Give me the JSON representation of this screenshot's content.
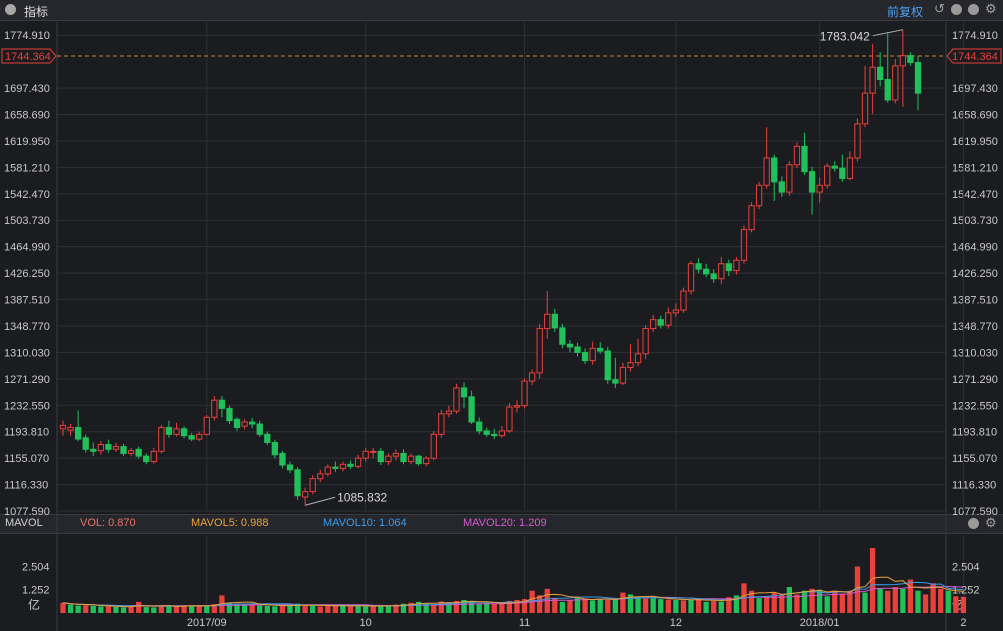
{
  "header": {
    "title": "指标",
    "fq_label": "前复权"
  },
  "volume_header": {
    "name": "MAVOL",
    "vol": "VOL: 0.870",
    "ma5": "MAVOL5: 0.988",
    "ma10": "MAVOL10: 1.064",
    "ma20": "MAVOL20: 1.209"
  },
  "colors": {
    "up": "#e8413c",
    "down": "#22c05a",
    "ma5": "#e8a33c",
    "ma10": "#3c9be8",
    "ma20": "#d25bd2",
    "bg": "#1b1c20",
    "grid": "#2e3036"
  },
  "chart_data": [
    {
      "type": "candlestick",
      "y_ticks": [
        "1774.910",
        "1697.430",
        "1658.690",
        "1619.950",
        "1581.210",
        "1542.470",
        "1503.730",
        "1464.990",
        "1426.250",
        "1387.510",
        "1348.770",
        "1310.030",
        "1271.290",
        "1232.550",
        "1193.810",
        "1155.070",
        "1116.330",
        "1077.590"
      ],
      "ylim": [
        1077.59,
        1794.28
      ],
      "current_price": "1744.364",
      "max_label": "1783.042",
      "min_label": "1085.832",
      "x_ticks": [
        "2017/09",
        "10",
        "11",
        "12",
        "2018/01",
        "2"
      ],
      "x_tick_index": [
        19,
        40,
        61,
        81,
        100,
        119
      ],
      "candles": [
        [
          1198,
          1203,
          1188,
          1210
        ],
        [
          1196,
          1200,
          1188,
          1205
        ],
        [
          1200,
          1183,
          1180,
          1225
        ],
        [
          1185,
          1168,
          1163,
          1190
        ],
        [
          1168,
          1165,
          1158,
          1178
        ],
        [
          1166,
          1175,
          1160,
          1180
        ],
        [
          1175,
          1168,
          1163,
          1182
        ],
        [
          1168,
          1172,
          1164,
          1178
        ],
        [
          1172,
          1162,
          1158,
          1176
        ],
        [
          1162,
          1166,
          1158,
          1170
        ],
        [
          1168,
          1158,
          1154,
          1172
        ],
        [
          1158,
          1150,
          1146,
          1162
        ],
        [
          1150,
          1165,
          1147,
          1170
        ],
        [
          1165,
          1200,
          1162,
          1204
        ],
        [
          1200,
          1190,
          1185,
          1210
        ],
        [
          1190,
          1198,
          1187,
          1207
        ],
        [
          1198,
          1188,
          1184,
          1202
        ],
        [
          1188,
          1183,
          1180,
          1192
        ],
        [
          1183,
          1190,
          1180,
          1194
        ],
        [
          1190,
          1215,
          1188,
          1218
        ],
        [
          1215,
          1240,
          1210,
          1246
        ],
        [
          1240,
          1228,
          1215,
          1246
        ],
        [
          1228,
          1210,
          1205,
          1232
        ],
        [
          1212,
          1200,
          1195,
          1215
        ],
        [
          1202,
          1208,
          1197,
          1212
        ],
        [
          1208,
          1205,
          1199,
          1214
        ],
        [
          1205,
          1190,
          1186,
          1210
        ],
        [
          1190,
          1178,
          1174,
          1194
        ],
        [
          1178,
          1160,
          1155,
          1182
        ],
        [
          1162,
          1145,
          1140,
          1166
        ],
        [
          1145,
          1138,
          1133,
          1150
        ],
        [
          1138,
          1100,
          1094,
          1142
        ],
        [
          1098,
          1106,
          1086,
          1112
        ],
        [
          1106,
          1125,
          1102,
          1130
        ],
        [
          1125,
          1132,
          1120,
          1138
        ],
        [
          1132,
          1142,
          1128,
          1146
        ],
        [
          1142,
          1140,
          1135,
          1150
        ],
        [
          1140,
          1146,
          1136,
          1150
        ],
        [
          1146,
          1143,
          1139,
          1152
        ],
        [
          1143,
          1155,
          1140,
          1160
        ],
        [
          1155,
          1165,
          1150,
          1170
        ],
        [
          1165,
          1165,
          1155,
          1170
        ],
        [
          1165,
          1150,
          1145,
          1170
        ],
        [
          1150,
          1158,
          1145,
          1162
        ],
        [
          1158,
          1162,
          1152,
          1168
        ],
        [
          1162,
          1150,
          1146,
          1168
        ],
        [
          1150,
          1158,
          1146,
          1162
        ],
        [
          1158,
          1147,
          1144,
          1160
        ],
        [
          1147,
          1155,
          1143,
          1158
        ],
        [
          1155,
          1190,
          1152,
          1195
        ],
        [
          1190,
          1220,
          1185,
          1226
        ],
        [
          1220,
          1224,
          1215,
          1232
        ],
        [
          1224,
          1258,
          1220,
          1264
        ],
        [
          1258,
          1245,
          1228,
          1266
        ],
        [
          1245,
          1208,
          1205,
          1254
        ],
        [
          1208,
          1195,
          1190,
          1215
        ],
        [
          1195,
          1190,
          1186,
          1200
        ],
        [
          1190,
          1188,
          1183,
          1198
        ],
        [
          1188,
          1195,
          1185,
          1202
        ],
        [
          1195,
          1230,
          1192,
          1236
        ],
        [
          1230,
          1232,
          1222,
          1240
        ],
        [
          1232,
          1268,
          1228,
          1272
        ],
        [
          1268,
          1280,
          1262,
          1285
        ],
        [
          1280,
          1345,
          1272,
          1352
        ],
        [
          1345,
          1366,
          1330,
          1400
        ],
        [
          1366,
          1346,
          1340,
          1374
        ],
        [
          1346,
          1322,
          1316,
          1352
        ],
        [
          1322,
          1318,
          1310,
          1328
        ],
        [
          1318,
          1310,
          1304,
          1324
        ],
        [
          1310,
          1298,
          1293,
          1316
        ],
        [
          1298,
          1316,
          1292,
          1326
        ],
        [
          1316,
          1312,
          1308,
          1325
        ],
        [
          1312,
          1270,
          1264,
          1318
        ],
        [
          1270,
          1265,
          1258,
          1302
        ],
        [
          1265,
          1288,
          1262,
          1295
        ],
        [
          1288,
          1295,
          1282,
          1322
        ],
        [
          1295,
          1308,
          1290,
          1330
        ],
        [
          1308,
          1345,
          1300,
          1350
        ],
        [
          1345,
          1358,
          1340,
          1365
        ],
        [
          1358,
          1350,
          1345,
          1364
        ],
        [
          1350,
          1368,
          1345,
          1376
        ],
        [
          1368,
          1372,
          1362,
          1382
        ],
        [
          1372,
          1400,
          1368,
          1405
        ],
        [
          1400,
          1440,
          1395,
          1444
        ],
        [
          1440,
          1432,
          1426,
          1448
        ],
        [
          1432,
          1425,
          1420,
          1440
        ],
        [
          1425,
          1418,
          1412,
          1432
        ],
        [
          1418,
          1440,
          1410,
          1450
        ],
        [
          1440,
          1430,
          1422,
          1446
        ],
        [
          1430,
          1445,
          1424,
          1450
        ],
        [
          1445,
          1490,
          1440,
          1496
        ],
        [
          1490,
          1525,
          1486,
          1530
        ],
        [
          1525,
          1555,
          1520,
          1560
        ],
        [
          1555,
          1595,
          1550,
          1640
        ],
        [
          1595,
          1560,
          1532,
          1600
        ],
        [
          1560,
          1545,
          1538,
          1568
        ],
        [
          1545,
          1585,
          1540,
          1590
        ],
        [
          1585,
          1612,
          1580,
          1618
        ],
        [
          1612,
          1575,
          1570,
          1632
        ],
        [
          1575,
          1545,
          1512,
          1582
        ],
        [
          1545,
          1555,
          1530,
          1566
        ],
        [
          1555,
          1583,
          1550,
          1587
        ],
        [
          1583,
          1580,
          1575,
          1590
        ],
        [
          1580,
          1565,
          1560,
          1600
        ],
        [
          1565,
          1595,
          1562,
          1605
        ],
        [
          1595,
          1645,
          1590,
          1653
        ],
        [
          1645,
          1690,
          1640,
          1730
        ],
        [
          1690,
          1728,
          1660,
          1762
        ],
        [
          1728,
          1710,
          1700,
          1750
        ],
        [
          1710,
          1680,
          1676,
          1778
        ],
        [
          1680,
          1730,
          1675,
          1740
        ],
        [
          1730,
          1745,
          1670,
          1783
        ],
        [
          1745,
          1735,
          1730,
          1750
        ],
        [
          1735,
          1690,
          1665,
          1744
        ]
      ],
      "volume": [
        [
          0.55,
          1
        ],
        [
          0.45,
          0
        ],
        [
          0.4,
          0
        ],
        [
          0.42,
          1
        ],
        [
          0.38,
          0
        ],
        [
          0.35,
          0
        ],
        [
          0.36,
          1
        ],
        [
          0.33,
          0
        ],
        [
          0.3,
          0
        ],
        [
          0.34,
          1
        ],
        [
          0.6,
          1
        ],
        [
          0.32,
          0
        ],
        [
          0.3,
          0
        ],
        [
          0.36,
          1
        ],
        [
          0.4,
          0
        ],
        [
          0.38,
          1
        ],
        [
          0.42,
          1
        ],
        [
          0.36,
          0
        ],
        [
          0.4,
          1
        ],
        [
          0.35,
          0
        ],
        [
          0.48,
          1
        ],
        [
          0.95,
          1
        ],
        [
          0.55,
          0
        ],
        [
          0.5,
          0
        ],
        [
          0.45,
          0
        ],
        [
          0.48,
          1
        ],
        [
          0.4,
          0
        ],
        [
          0.38,
          0
        ],
        [
          0.36,
          0
        ],
        [
          0.4,
          1
        ],
        [
          0.45,
          0
        ],
        [
          0.5,
          0
        ],
        [
          0.4,
          1
        ],
        [
          0.38,
          0
        ],
        [
          0.35,
          1
        ],
        [
          0.4,
          1
        ],
        [
          0.42,
          1
        ],
        [
          0.38,
          0
        ],
        [
          0.36,
          1
        ],
        [
          0.4,
          0
        ],
        [
          0.35,
          0
        ],
        [
          0.38,
          1
        ],
        [
          0.4,
          0
        ],
        [
          0.36,
          0
        ],
        [
          0.45,
          1
        ],
        [
          0.5,
          0
        ],
        [
          0.55,
          1
        ],
        [
          0.6,
          0
        ],
        [
          0.5,
          0
        ],
        [
          0.45,
          1
        ],
        [
          0.62,
          1
        ],
        [
          0.58,
          0
        ],
        [
          0.65,
          1
        ],
        [
          0.7,
          0
        ],
        [
          0.6,
          0
        ],
        [
          0.52,
          0
        ],
        [
          0.55,
          0
        ],
        [
          0.48,
          1
        ],
        [
          0.5,
          1
        ],
        [
          0.65,
          1
        ],
        [
          0.7,
          1
        ],
        [
          0.75,
          1
        ],
        [
          1.2,
          1
        ],
        [
          0.95,
          1
        ],
        [
          1.3,
          1
        ],
        [
          0.8,
          1
        ],
        [
          0.6,
          0
        ],
        [
          0.7,
          1
        ],
        [
          0.85,
          0
        ],
        [
          0.78,
          1
        ],
        [
          0.68,
          0
        ],
        [
          0.75,
          0
        ],
        [
          0.7,
          1
        ],
        [
          0.72,
          0
        ],
        [
          1.1,
          1
        ],
        [
          1.0,
          0
        ],
        [
          0.85,
          0
        ],
        [
          0.78,
          1
        ],
        [
          0.8,
          0
        ],
        [
          0.75,
          0
        ],
        [
          0.72,
          1
        ],
        [
          0.7,
          0
        ],
        [
          0.68,
          1
        ],
        [
          0.72,
          0
        ],
        [
          0.78,
          1
        ],
        [
          0.6,
          0
        ],
        [
          0.65,
          1
        ],
        [
          0.62,
          0
        ],
        [
          0.85,
          1
        ],
        [
          0.95,
          0
        ],
        [
          1.6,
          1
        ],
        [
          1.2,
          1
        ],
        [
          0.8,
          0
        ],
        [
          0.9,
          1
        ],
        [
          1.1,
          1
        ],
        [
          1.0,
          1
        ],
        [
          1.4,
          0
        ],
        [
          1.0,
          1
        ],
        [
          1.2,
          0
        ],
        [
          1.3,
          1
        ],
        [
          1.25,
          0
        ],
        [
          0.9,
          0
        ],
        [
          1.2,
          1
        ],
        [
          1.05,
          1
        ],
        [
          1.2,
          1
        ],
        [
          2.5,
          1
        ],
        [
          1.1,
          0
        ],
        [
          3.5,
          1
        ],
        [
          1.3,
          0
        ],
        [
          1.2,
          1
        ],
        [
          1.4,
          1
        ],
        [
          1.3,
          0
        ],
        [
          1.8,
          1
        ],
        [
          1.2,
          0
        ],
        [
          1.0,
          1
        ],
        [
          1.6,
          1
        ],
        [
          1.3,
          1
        ],
        [
          1.2,
          0
        ],
        [
          0.9,
          1
        ],
        [
          0.87,
          1
        ]
      ],
      "vol_ticks": [
        "2.504",
        "1.252",
        "亿"
      ],
      "vol_max": 4.2
    }
  ]
}
